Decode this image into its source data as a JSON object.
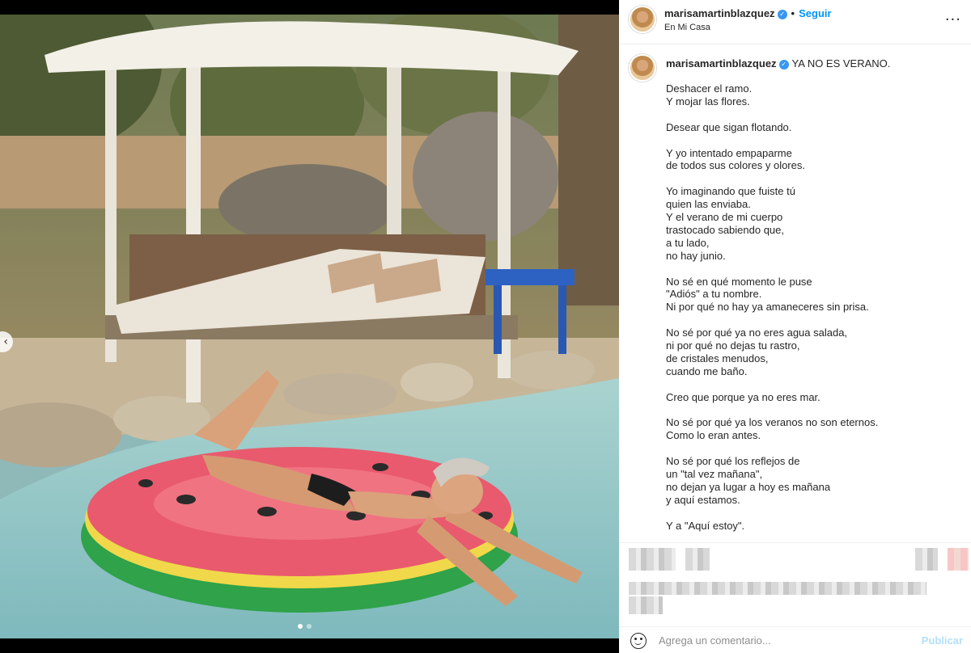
{
  "post": {
    "username": "marisamartinblazquez",
    "follow_label": "Seguir",
    "separator": "•",
    "location": "En Mi Casa",
    "more_label": "···",
    "verified_glyph": "✓"
  },
  "caption": {
    "lead": "YA NO ES VERANO.",
    "stanzas": [
      [
        "Deshacer el ramo.",
        "Y mojar las flores."
      ],
      [
        "Desear que sigan flotando."
      ],
      [
        "Y yo intentado empaparme",
        "de todos sus colores y olores."
      ],
      [
        "Yo imaginando que fuiste tú",
        "quien las enviaba.",
        "Y el verano de mi cuerpo",
        "trastocado sabiendo que,",
        "a tu lado,",
        "no hay junio."
      ],
      [
        "No sé en qué momento le puse",
        "\"Adiós\" a tu nombre.",
        "Ni por qué no hay ya amaneceres sin prisa."
      ],
      [
        "No sé por qué ya no eres agua salada,",
        "ni por qué no dejas tu rastro,",
        "de cristales menudos,",
        "cuando me baño."
      ],
      [
        "Creo que porque ya no eres mar."
      ],
      [
        "No sé por qué ya los veranos no son eternos.",
        "Como lo eran antes."
      ],
      [
        "No sé por qué los reflejos de",
        "un \"tal vez mañana\",",
        "no dejan ya lugar a hoy es mañana",
        "y aquí estamos."
      ],
      [
        "Y a \"Aquí estoy\"."
      ]
    ]
  },
  "comment": {
    "placeholder": "Agrega un comentario...",
    "publish_label": "Publicar"
  },
  "media": {
    "prev_arrow": "‹",
    "carousel_dots": 2,
    "active_dot": 0
  },
  "colors": {
    "accent": "#0095f6",
    "verified": "#3897f0",
    "publish_disabled": "#b2dffc"
  },
  "icons": [
    "verified-badge-icon",
    "more-options-icon",
    "emoji-icon",
    "chevron-left-icon"
  ]
}
